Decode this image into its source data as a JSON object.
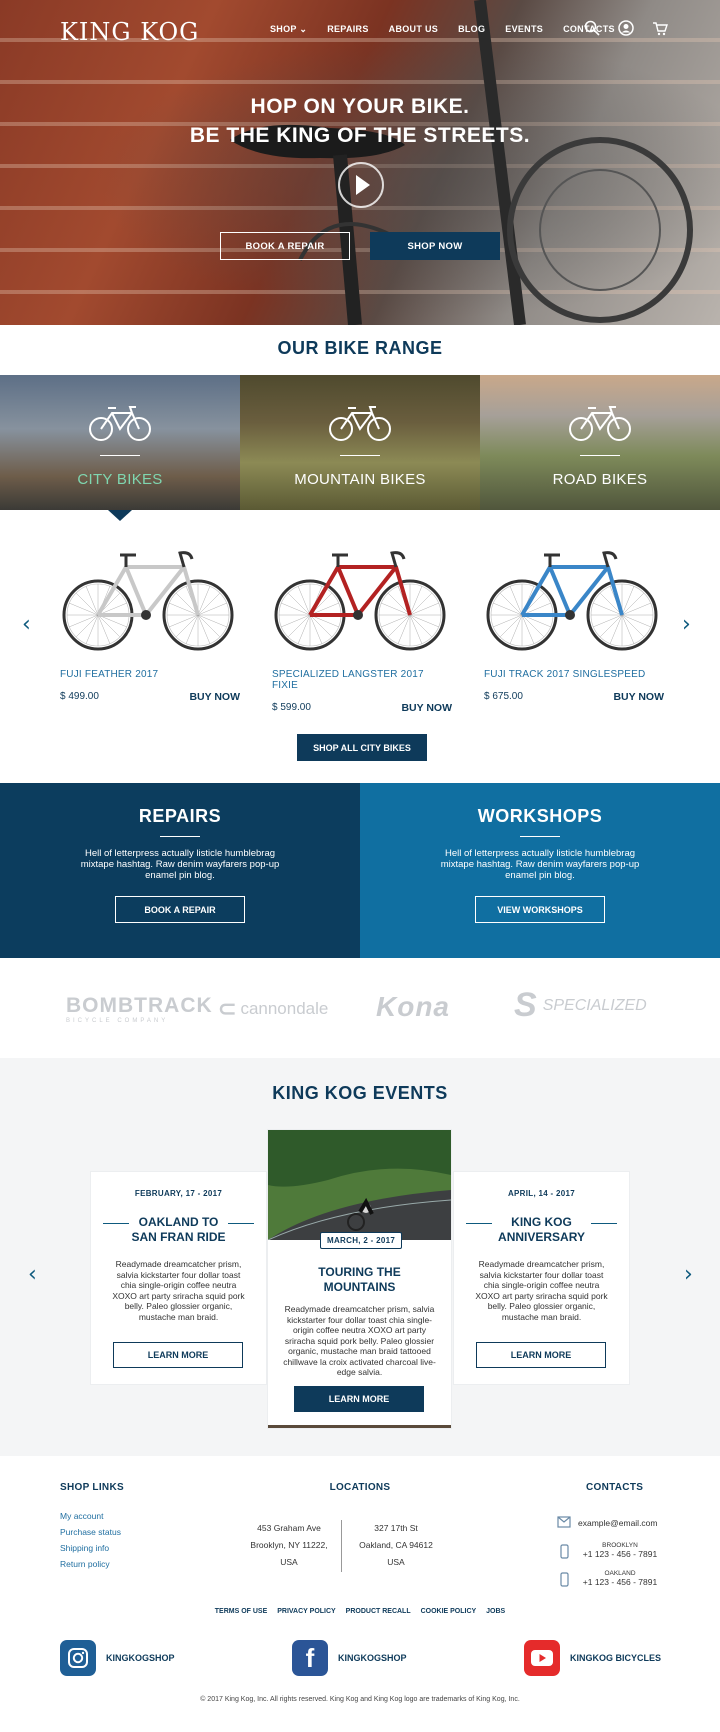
{
  "header": {
    "logo": "KING KOG",
    "nav": [
      "SHOP",
      "REPAIRS",
      "ABOUT US",
      "BLOG",
      "EVENTS",
      "CONTACTS"
    ],
    "icons": [
      "search-icon",
      "account-icon",
      "cart-icon"
    ]
  },
  "hero": {
    "line1": "HOP ON YOUR BIKE.",
    "line2": "BE THE KING  OF THE STREETS.",
    "btn_repair": "BOOK A REPAIR",
    "btn_shop": "SHOP NOW"
  },
  "range": {
    "title": "OUR BIKE RANGE",
    "categories": [
      "CITY BIKES",
      "MOUNTAIN BIKES",
      "ROAD BIKES"
    ],
    "products": [
      {
        "name": "FUJI FEATHER 2017",
        "price": "$ 499.00",
        "buy": "BUY NOW",
        "frame": "#c8c8c8"
      },
      {
        "name": "SPECIALIZED LANGSTER 2017 FIXIE",
        "price": "$ 599.00",
        "buy": "BUY NOW",
        "frame": "#b32222"
      },
      {
        "name": "FUJI TRACK 2017 SINGLESPEED",
        "price": "$ 675.00",
        "buy": "BUY NOW",
        "frame": "#3a86c8"
      }
    ],
    "shop_all": "SHOP ALL CITY BIKES"
  },
  "panels": {
    "repairs": {
      "title": "REPAIRS",
      "text": "Hell of letterpress actually listicle humblebrag mixtape hashtag. Raw denim wayfarers pop-up enamel pin blog.",
      "btn": "BOOK A REPAIR"
    },
    "workshops": {
      "title": "WORKSHOPS",
      "text": "Hell of letterpress actually listicle humblebrag mixtape hashtag. Raw denim wayfarers pop-up enamel pin blog.",
      "btn": "VIEW WORKSHOPS"
    }
  },
  "brands": [
    "BOMBTRACK",
    "cannondale",
    "Kona",
    "SPECIALIZED"
  ],
  "brand_sub": "BICYCLE COMPANY",
  "events": {
    "title": "KING KOG EVENTS",
    "cards": [
      {
        "date": "FEBRUARY, 17 - 2017",
        "title": "OAKLAND TO SAN FRAN RIDE",
        "text": "Readymade dreamcatcher prism, salvia kickstarter four dollar toast chia single-origin coffee neutra XOXO art party sriracha squid pork belly. Paleo glossier organic, mustache man braid.",
        "btn": "LEARN MORE"
      },
      {
        "date": "MARCH, 2 - 2017",
        "title": "TOURING THE MOUNTAINS",
        "text": "Readymade dreamcatcher prism, salvia kickstarter four dollar toast chia single-origin coffee neutra XOXO art party sriracha squid pork belly. Paleo glossier organic, mustache man braid tattooed chillwave la croix activated charcoal live-edge salvia.",
        "btn": "LEARN MORE"
      },
      {
        "date": "APRIL, 14 - 2017",
        "title": "KING KOG ANNIVERSARY",
        "text": "Readymade dreamcatcher prism, salvia kickstarter four dollar toast chia single-origin coffee neutra XOXO art party sriracha squid pork belly. Paleo glossier organic, mustache man braid.",
        "btn": "LEARN MORE"
      }
    ]
  },
  "footer": {
    "shop_links_title": "SHOP LINKS",
    "shop_links": [
      "My account",
      "Purchase status",
      "Shipping info",
      "Return policy"
    ],
    "locations_title": "LOCATIONS",
    "loc1": [
      "453 Graham Ave",
      "Brooklyn, NY 11222,",
      "USA"
    ],
    "loc2": [
      "327 17th St",
      "Oakland, CA 94612",
      "USA"
    ],
    "contacts_title": "CONTACTS",
    "email": "example@email.com",
    "phone1_label": "BROOKLYN",
    "phone1": "+1 123 - 456 - 7891",
    "phone2_label": "OAKLAND",
    "phone2": "+1 123 - 456 - 7891",
    "legal": [
      "TERMS OF USE",
      "PRIVACY POLICY",
      "PRODUCT RECALL",
      "COOKIE POLICY",
      "JOBS"
    ],
    "social": [
      {
        "name": "KINGKOGSHOP",
        "icon": "instagram-icon",
        "color": "#1f5f96"
      },
      {
        "name": "KINGKOGSHOP",
        "icon": "facebook-icon",
        "color": "#2b5597"
      },
      {
        "name": "KINGKOG BICYCLES",
        "icon": "youtube-icon",
        "color": "#e52b2b"
      }
    ],
    "copyright": "© 2017 King Kog, Inc. All rights reserved. King Kog and King Kog logo are trademarks of King Kog, Inc."
  }
}
